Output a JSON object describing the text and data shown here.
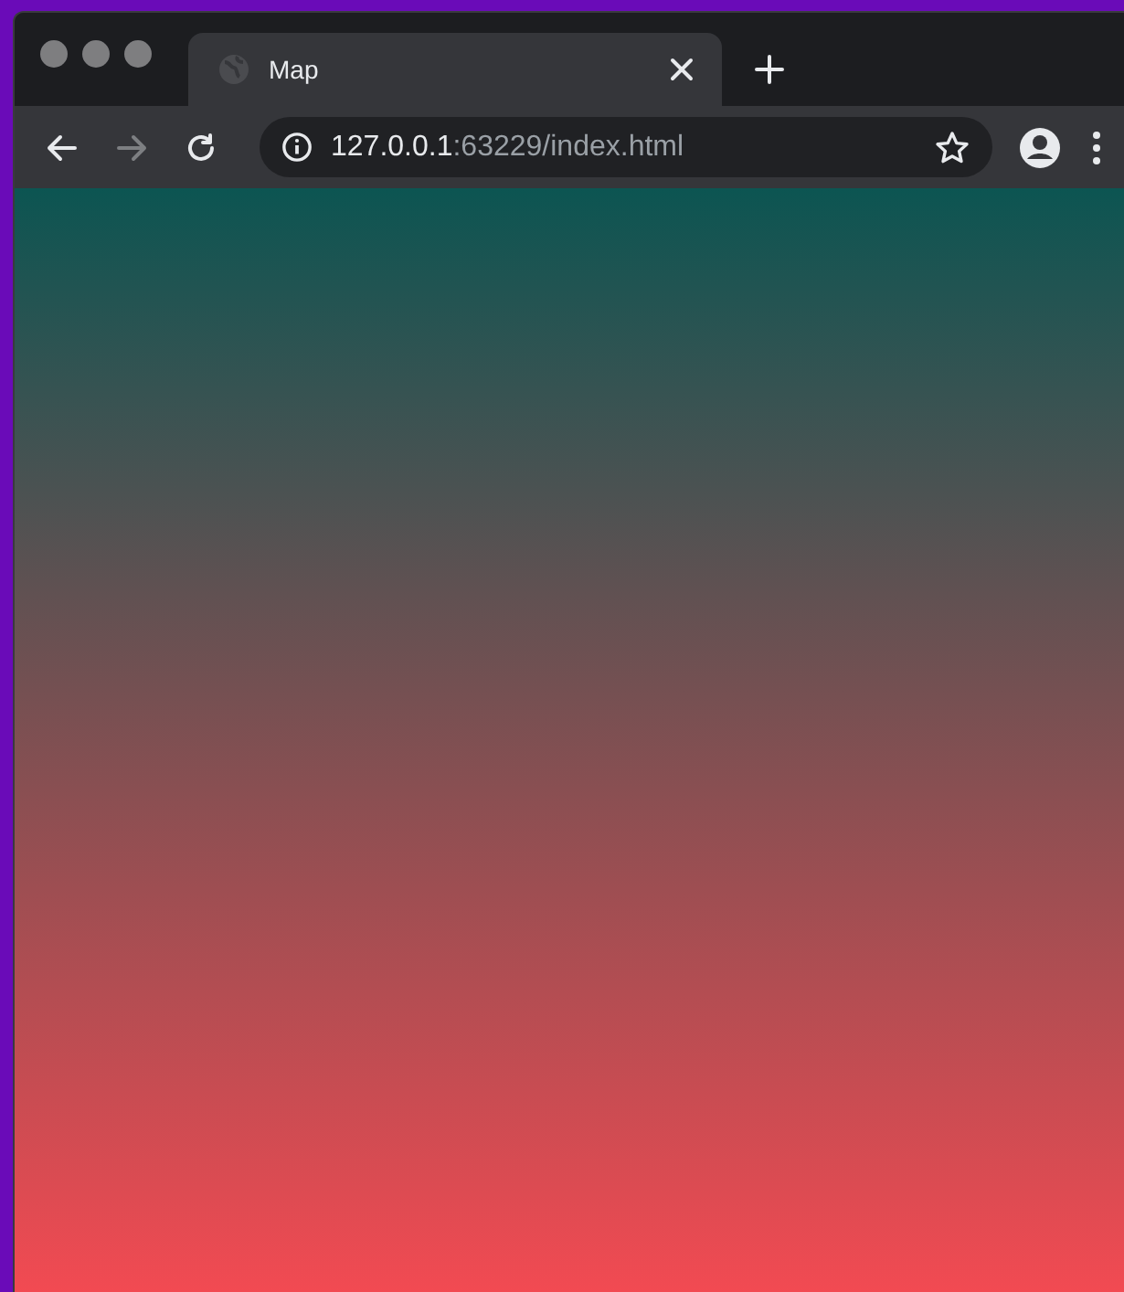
{
  "tabs": [
    {
      "title": "Map",
      "selected": true
    }
  ],
  "toolbar": {
    "back_disabled": false,
    "forward_disabled": true
  },
  "address": {
    "host": "127.0.0.1",
    "path": ":63229/index.html",
    "bookmarked": false
  }
}
